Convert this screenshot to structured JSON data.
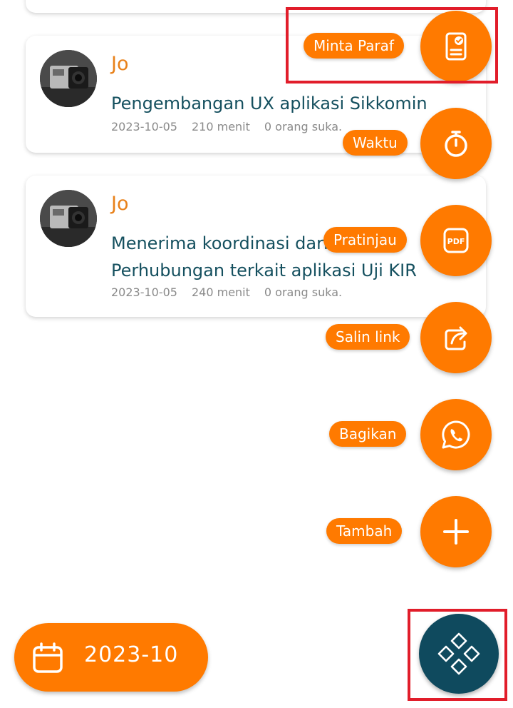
{
  "posts": [
    {
      "author": "Jo",
      "title": "Pengembangan UX aplikasi Sikkomin",
      "date": "2023-10-05",
      "duration": "210 menit",
      "likes": "0 orang suka."
    },
    {
      "author": "Jo",
      "title_line1": "Menerima koordinasi dari Dinas",
      "title_line2": "Perhubungan terkait aplikasi Uji KIR",
      "date": "2023-10-05",
      "duration": "240 menit",
      "likes": "0 orang suka."
    }
  ],
  "fab_menu": {
    "items": [
      {
        "label": "Minta Paraf",
        "icon": "document-sign-icon"
      },
      {
        "label": "Waktu",
        "icon": "stopwatch-icon"
      },
      {
        "label": "Pratinjau",
        "icon": "pdf-icon"
      },
      {
        "label": "Salin link",
        "icon": "share-icon"
      },
      {
        "label": "Bagikan",
        "icon": "whatsapp-icon"
      },
      {
        "label": "Tambah",
        "icon": "plus-icon"
      }
    ]
  },
  "month_filter": {
    "label": "2023-10",
    "icon": "calendar-icon"
  },
  "main_fab": {
    "icon": "diamond-grid-icon"
  },
  "colors": {
    "accent": "#ff7a00",
    "primary_dark": "#0f4a5e",
    "title_text": "#15505f",
    "author_text": "#e8811a",
    "meta_text": "#8a8a8a",
    "highlight": "#e11d2a"
  }
}
